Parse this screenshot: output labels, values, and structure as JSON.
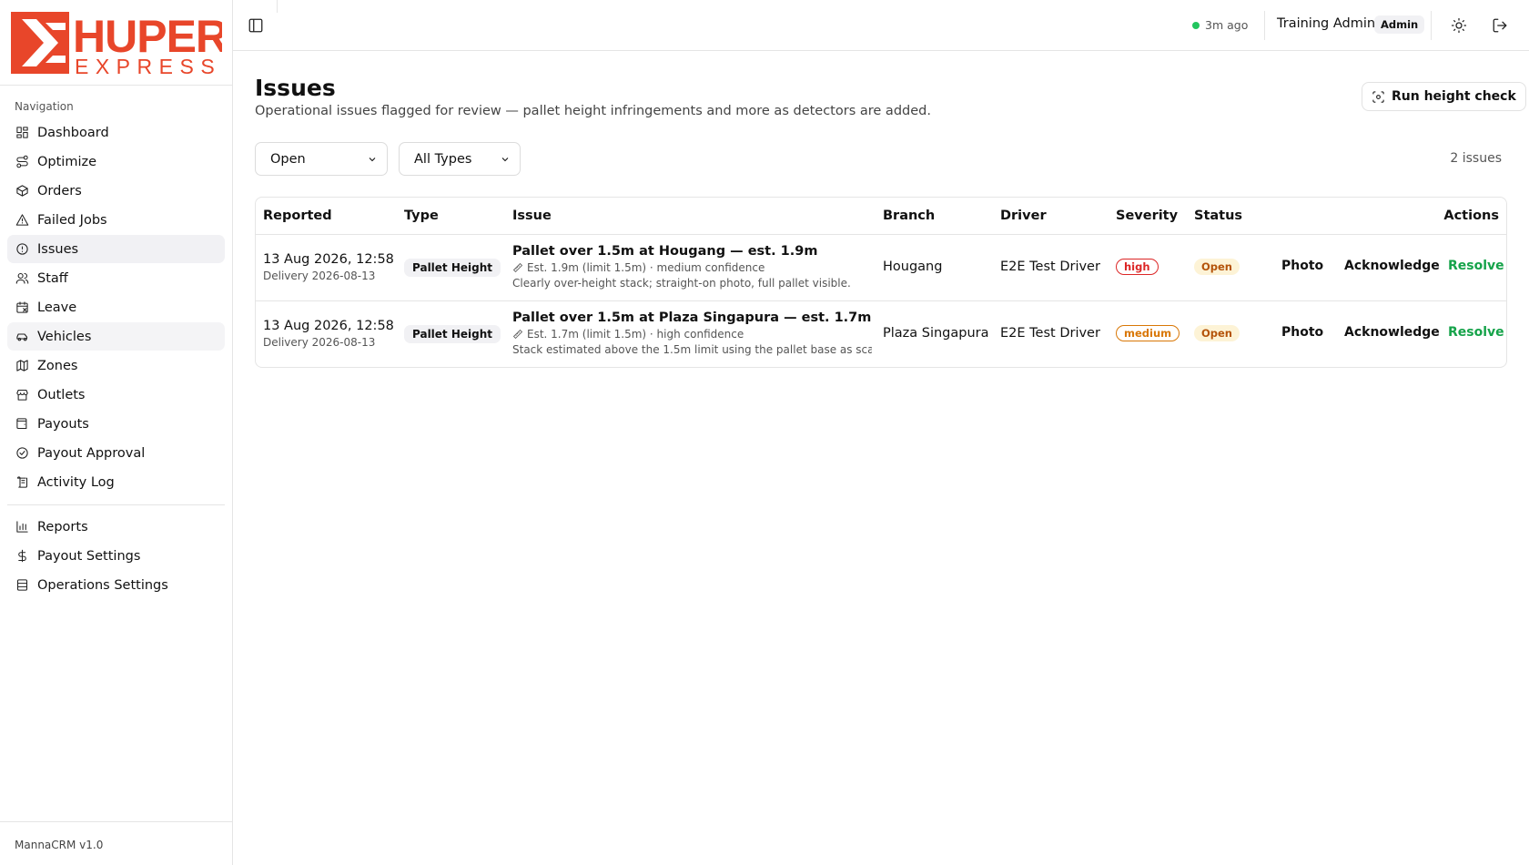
{
  "brand": {
    "name": "HUPER",
    "sub": "EXPRESS",
    "color": "#e8462a"
  },
  "sidebar": {
    "heading": "Navigation",
    "items": [
      {
        "label": "Dashboard",
        "icon": "layout-grid-icon"
      },
      {
        "label": "Optimize",
        "icon": "route-icon"
      },
      {
        "label": "Orders",
        "icon": "package-icon"
      },
      {
        "label": "Failed Jobs",
        "icon": "alert-triangle-icon"
      },
      {
        "label": "Issues",
        "icon": "alert-circle-icon"
      },
      {
        "label": "Staff",
        "icon": "users-icon"
      },
      {
        "label": "Leave",
        "icon": "calendar-off-icon"
      },
      {
        "label": "Vehicles",
        "icon": "car-icon"
      },
      {
        "label": "Zones",
        "icon": "map-icon"
      },
      {
        "label": "Outlets",
        "icon": "store-icon"
      },
      {
        "label": "Payouts",
        "icon": "wallet-icon"
      },
      {
        "label": "Payout Approval",
        "icon": "check-circle-icon"
      },
      {
        "label": "Activity Log",
        "icon": "scroll-icon"
      }
    ],
    "secondary": [
      {
        "label": "Reports",
        "icon": "bar-chart-icon"
      },
      {
        "label": "Payout Settings",
        "icon": "dollar-icon"
      },
      {
        "label": "Operations Settings",
        "icon": "database-icon"
      }
    ],
    "footer": "MannaCRM v1.0"
  },
  "topbar": {
    "sync": "3m ago",
    "user_name": "Training Admin",
    "role": "Admin"
  },
  "page": {
    "title": "Issues",
    "subtitle": "Operational issues flagged for review — pallet height infringements and more as detectors are added.",
    "run_button": "Run height check"
  },
  "filters": {
    "status": "Open",
    "type": "All Types",
    "count": "2 issues"
  },
  "table": {
    "headers": [
      "Reported",
      "Type",
      "Issue",
      "Branch",
      "Driver",
      "Severity",
      "Status",
      "Actions"
    ],
    "rows": [
      {
        "date": "13 Aug 2026, 12:58",
        "delivery": "Delivery 2026-08-13",
        "type": "Pallet Height",
        "title": "Pallet over 1.5m at Hougang — est. 1.9m",
        "meta": "Est. 1.9m (limit 1.5m) · medium confidence",
        "note": "Clearly over-height stack; straight-on photo, full pallet visible.",
        "branch": "Hougang",
        "driver": "E2E Test Driver",
        "severity": "high",
        "status": "Open",
        "actions": {
          "photo": "Photo",
          "ack": "Acknowledge",
          "resolve": "Resolve"
        }
      },
      {
        "date": "13 Aug 2026, 12:58",
        "delivery": "Delivery 2026-08-13",
        "type": "Pallet Height",
        "title": "Pallet over 1.5m at Plaza Singapura — est. 1.7m",
        "meta": "Est. 1.7m (limit 1.5m) · high confidence",
        "note": "Stack estimated above the 1.5m limit using the pallet base as sca",
        "branch": "Plaza Singapura",
        "driver": "E2E Test Driver",
        "severity": "medium",
        "status": "Open",
        "actions": {
          "photo": "Photo",
          "ack": "Acknowledge",
          "resolve": "Resolve"
        }
      }
    ]
  }
}
